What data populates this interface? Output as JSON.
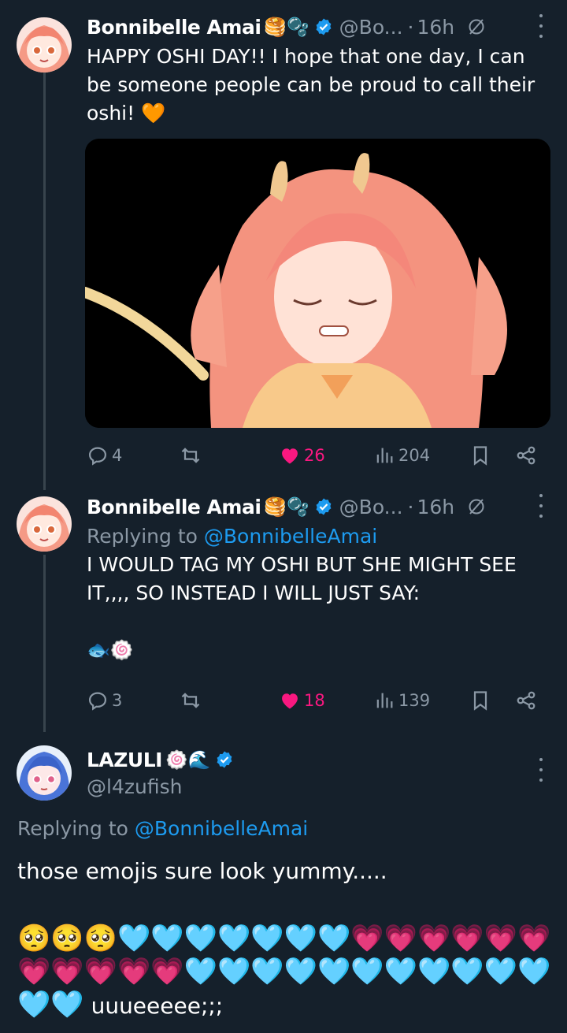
{
  "tweet1": {
    "author_name": "Bonnibelle Amai",
    "author_emojis": "🥞🫧",
    "handle": "@Bo...",
    "separator": "·",
    "time": "16h",
    "text": "HAPPY OSHI DAY!! I hope that one day, I can be someone people can be proud to call their oshi! 🧡",
    "stats": {
      "replies": "4",
      "likes": "26",
      "views": "204"
    },
    "liked": true
  },
  "tweet2": {
    "author_name": "Bonnibelle Amai",
    "author_emojis": "🥞🫧",
    "handle": "@Bo...",
    "separator": "·",
    "time": "16h",
    "replying_prefix": "Replying to ",
    "replying_to": "@BonnibelleAmai",
    "text": "I WOULD TAG MY OSHI BUT SHE MIGHT SEE IT,,,, SO INSTEAD I WILL JUST SAY:",
    "emojis": "🐟🍥",
    "stats": {
      "replies": "3",
      "likes": "18",
      "views": "139"
    },
    "liked": true
  },
  "tweet3": {
    "author_name": "LAZULI",
    "author_emojis": "🍥🌊",
    "handle": "@l4zufish",
    "replying_prefix": "Replying to ",
    "replying_to": "@BonnibelleAmai",
    "text": "those emojis sure look yummy.....",
    "emoji_line1": "🥺🥺🥺🩵🩵🩵🩵🩵🩵🩵💗💗💗💗💗💗",
    "emoji_line2": "💗💗💗💗💗🩵🩵🩵🩵🩵🩵🩵🩵🩵🩵🩵",
    "emoji_line3_emojis": "🩵🩵",
    "emoji_line3_text": " uuueeeee;;;"
  },
  "colors": {
    "background": "#15202b",
    "text": "#ffffff",
    "muted": "#8b98a5",
    "accent": "#1d9bf0",
    "like": "#f91880",
    "thread_line": "#38444d"
  },
  "icons": [
    "reply-icon",
    "retweet-icon",
    "heart-icon",
    "views-icon",
    "bookmark-icon",
    "share-icon",
    "verified-icon",
    "grok-icon",
    "more-icon"
  ]
}
